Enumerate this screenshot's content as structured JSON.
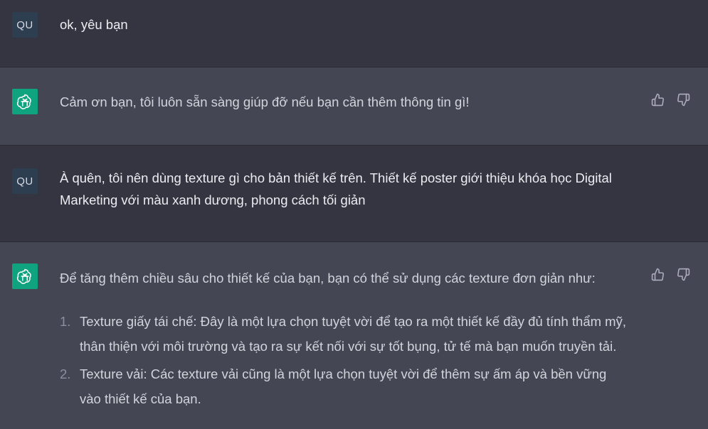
{
  "conversation": {
    "messages": [
      {
        "role": "user",
        "avatar_text": "QU",
        "text": "ok, yêu bạn"
      },
      {
        "role": "assistant",
        "text": "Cảm ơn bạn, tôi luôn sẵn sàng giúp đỡ nếu bạn cần thêm thông tin gì!"
      },
      {
        "role": "user",
        "avatar_text": "QU",
        "text": "À quên, tôi nên dùng texture gì cho bản thiết kế trên. Thiết kế poster giới thiệu khóa học Digital Marketing với màu xanh dương, phong cách tối giản"
      },
      {
        "role": "assistant",
        "intro": "Để tăng thêm chiều sâu cho thiết kế của bạn, bạn có thể sử dụng các texture đơn giản như:",
        "list": [
          {
            "num": "1.",
            "text": "Texture giấy tái chế: Đây là một lựa chọn tuyệt vời để tạo ra một thiết kế đầy đủ tính thẩm mỹ, thân thiện với môi trường và tạo ra sự kết nối với sự tốt bụng, tử tế mà bạn muốn truyền tải."
          },
          {
            "num": "2.",
            "text": "Texture vải: Các texture vải cũng là một lựa chọn tuyệt vời để thêm sự ấm áp và bền vững vào thiết kế của bạn."
          }
        ]
      }
    ]
  },
  "icons": {
    "assistant_avatar": "openai-logo-icon",
    "thumbs_up": "thumbs-up-icon",
    "thumbs_down": "thumbs-down-icon"
  },
  "colors": {
    "assistant_avatar_bg": "#10a37f",
    "user_avatar_bg": "#2c3e50",
    "user_row_bg": "#343541",
    "assistant_row_bg": "#444654"
  }
}
